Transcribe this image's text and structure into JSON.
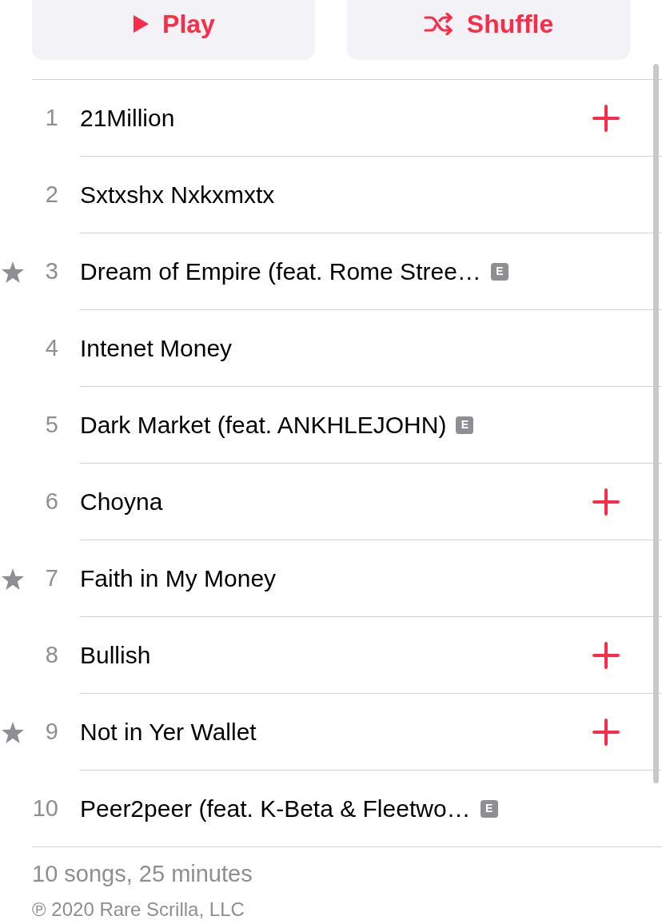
{
  "actions": [
    {
      "kind": "play",
      "label": "Play"
    },
    {
      "kind": "shuffle",
      "label": "Shuffle"
    }
  ],
  "tracks": [
    {
      "number": "1",
      "title": "21Million",
      "favorite": false,
      "add_button": true
    },
    {
      "number": "2",
      "title": "Sxtxshx Nxkxmxtx",
      "favorite": false,
      "add_button": false
    },
    {
      "number": "3",
      "title": "Dream of Empire (feat. Rome Stree…",
      "favorite": true,
      "badge": "E",
      "add_button": false
    },
    {
      "number": "4",
      "title": "Intenet Money",
      "favorite": false,
      "add_button": false
    },
    {
      "number": "5",
      "title": "Dark Market (feat. ANKHLEJOHN)",
      "favorite": false,
      "badge": "E",
      "add_button": false
    },
    {
      "number": "6",
      "title": "Choyna",
      "favorite": false,
      "add_button": true
    },
    {
      "number": "7",
      "title": "Faith in My Money",
      "favorite": true,
      "add_button": false
    },
    {
      "number": "8",
      "title": "Bullish",
      "favorite": false,
      "add_button": true
    },
    {
      "number": "9",
      "title": "Not in Yer Wallet",
      "favorite": true,
      "add_button": true
    },
    {
      "number": "10",
      "title": "Peer2peer (feat. K-Beta & Fleetwo…",
      "favorite": false,
      "badge": "E",
      "add_button": false
    }
  ],
  "summary": "10 songs, 25 minutes",
  "copyright": "℗ 2020 Rare Scrilla, LLC"
}
